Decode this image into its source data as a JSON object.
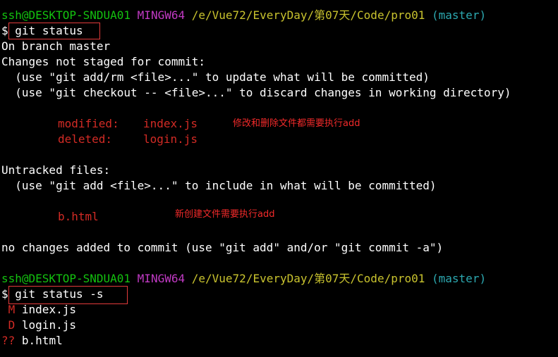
{
  "colors": {
    "background": "#000000",
    "text": "#ffffff",
    "prompt_user": "#13c30f",
    "prompt_env": "#c13ac4",
    "prompt_path": "#c9c32e",
    "prompt_branch": "#2ca9b1",
    "status_change": "#d32b25",
    "annotation": "#f22a2a",
    "highlight_box": "#e33b3b"
  },
  "prompt1": {
    "user_host": "ssh@DESKTOP-SNDUA01",
    "env": "MINGW64",
    "path": "/e/Vue72/EveryDay/第07天/Code/pro01",
    "branch": "(master)"
  },
  "command1": {
    "symbol": "$",
    "text": "git status"
  },
  "output1": {
    "on_branch": "On branch master",
    "changes_header": "Changes not staged for commit:",
    "hint_add": "  (use \"git add/rm <file>...\" to update what will be committed)",
    "hint_checkout": "  (use \"git checkout -- <file>...\" to discard changes in working directory)",
    "modified_label": "modified:",
    "modified_file": "index.js",
    "deleted_label": "deleted:",
    "deleted_file": "login.js",
    "untracked_header": "Untracked files:",
    "hint_untracked": "  (use \"git add <file>...\" to include in what will be committed)",
    "untracked_file": "b.html",
    "summary": "no changes added to commit (use \"git add\" and/or \"git commit -a\")"
  },
  "annotations": {
    "modified_deleted_note": "修改和删除文件都需要执行add",
    "new_file_note": "新创建文件需要执行add"
  },
  "prompt2": {
    "user_host": "ssh@DESKTOP-SNDUA01",
    "env": "MINGW64",
    "path": "/e/Vue72/EveryDay/第07天/Code/pro01",
    "branch": "(master)"
  },
  "command2": {
    "symbol": "$",
    "text": "git status -s"
  },
  "output2": {
    "rows": [
      {
        "code": " M",
        "file": "index.js"
      },
      {
        "code": " D",
        "file": "login.js"
      },
      {
        "code": "??",
        "file": "b.html"
      }
    ]
  }
}
